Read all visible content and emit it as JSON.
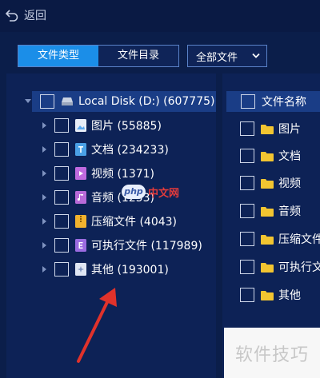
{
  "nav": {
    "back_label": "返回"
  },
  "tabs": [
    {
      "label": "文件类型",
      "active": true
    },
    {
      "label": "文件目录",
      "active": false
    }
  ],
  "filter": {
    "selected": "全部文件"
  },
  "tree": {
    "root": {
      "label": "Local Disk (D:) (607775)"
    },
    "items": [
      {
        "label": "图片 (55885)",
        "icon": "image-file-icon",
        "color": "#5aa9f0"
      },
      {
        "label": "文档 (234233)",
        "icon": "document-file-icon",
        "color": "#4aa0e6"
      },
      {
        "label": "视频 (1371)",
        "icon": "video-file-icon",
        "color": "#c06ae0"
      },
      {
        "label": "音频 (1253)",
        "icon": "audio-file-icon",
        "color": "#b86ad8"
      },
      {
        "label": "压缩文件 (4043)",
        "icon": "archive-file-icon",
        "color": "#f2b22e"
      },
      {
        "label": "可执行文件 (117989)",
        "icon": "executable-file-icon",
        "color": "#9b6be0"
      },
      {
        "label": "其他 (193001)",
        "icon": "other-file-icon",
        "color": "#dfe6f4"
      }
    ]
  },
  "right_list": {
    "header": "文件名称",
    "items": [
      "图片",
      "文档",
      "视频",
      "音频",
      "压缩文件",
      "可执行文",
      "其他"
    ]
  },
  "watermarks": {
    "php_badge": "php",
    "php_text": "中文网",
    "bottom_text": "软件技巧"
  },
  "colors": {
    "background": "#0b1e4a",
    "panel": "#0d2256",
    "selected_row": "#1a3d86",
    "active_tab": "#1b8ee8",
    "folder": "#f2c531",
    "annotation_arrow": "#e0322b"
  }
}
